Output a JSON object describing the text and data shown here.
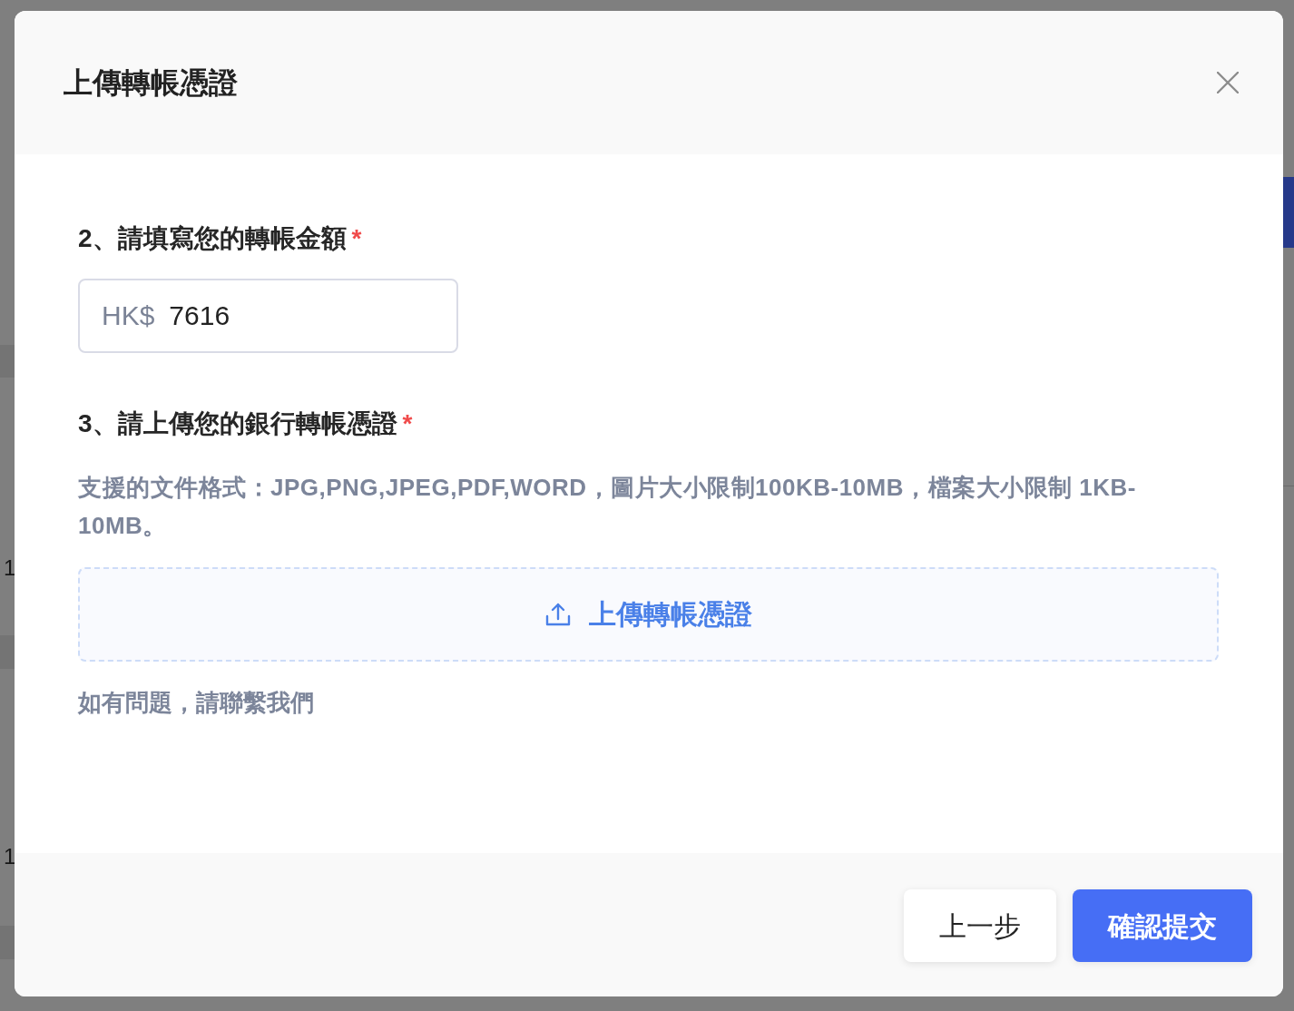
{
  "backdrop": {
    "fragments": [
      {
        "text": "1"
      },
      {
        "text": "1"
      }
    ]
  },
  "dialog": {
    "title": "上傳轉帳憑證"
  },
  "fields": [
    {
      "kind": "amount",
      "label": "2、請填寫您的轉帳金額",
      "required_mark": "*",
      "prefix": "HK$",
      "value": "7616"
    },
    {
      "kind": "upload",
      "label": "3、請上傳您的銀行轉帳憑證",
      "required_mark": "*",
      "hint": "支援的文件格式：JPG,PNG,JPEG,PDF,WORD，圖片大小限制100KB-10MB，檔案大小限制 1KB-10MB。",
      "button": "上傳轉帳憑證"
    }
  ],
  "help_text": "如有問題，請聯繫我們",
  "buttons": [
    {
      "kind": "secondary",
      "label": "上一步"
    },
    {
      "kind": "primary",
      "label": "確認提交"
    }
  ]
}
